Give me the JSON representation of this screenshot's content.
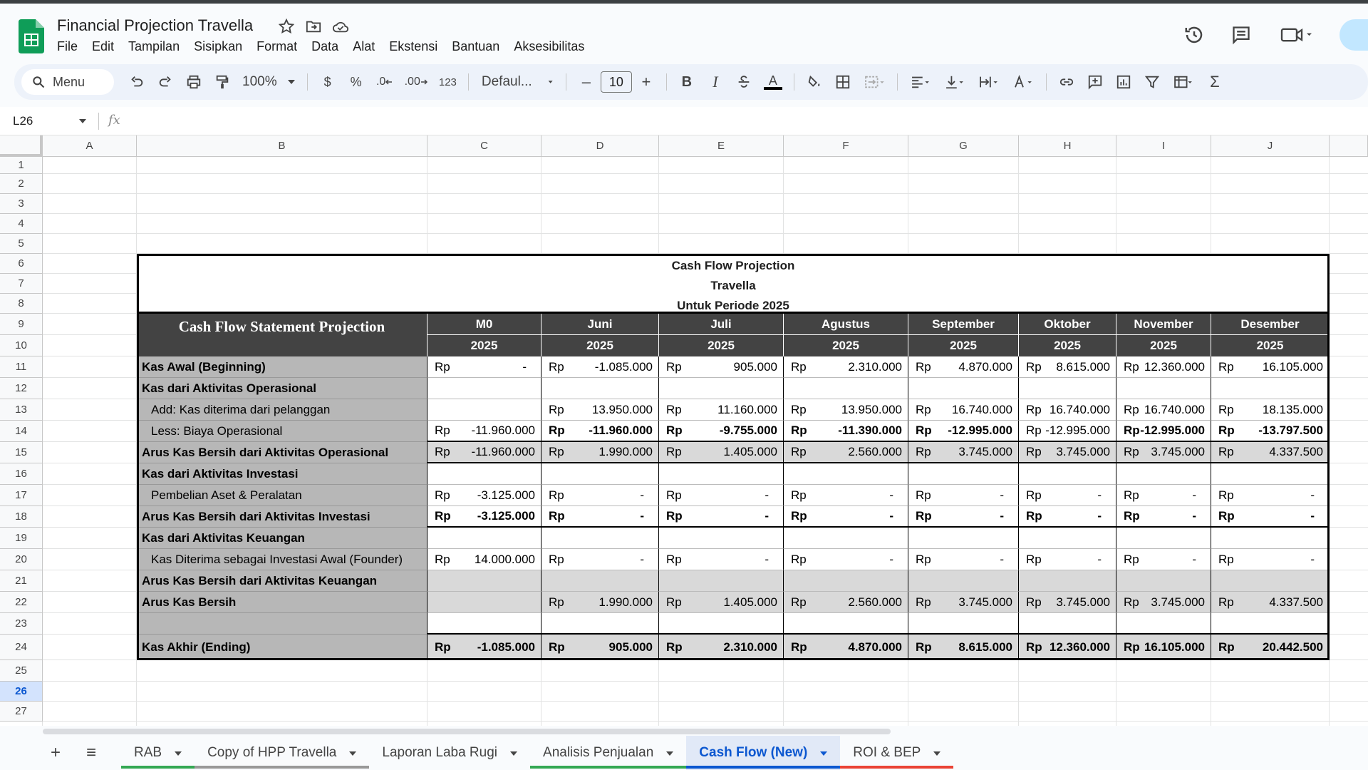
{
  "app": {
    "doc_title": "Financial Projection Travella",
    "menu": [
      "File",
      "Edit",
      "Tampilan",
      "Sisipkan",
      "Format",
      "Data",
      "Alat",
      "Ekstensi",
      "Bantuan",
      "Aksesibilitas"
    ]
  },
  "toolbar": {
    "search_label": "Menu",
    "zoom": "100%",
    "currency": "$",
    "percent": "%",
    "dec_dec": ".0",
    "dec_inc": ".00",
    "num_format": "123",
    "font": "Defaul...",
    "font_size": "10",
    "bold": "B",
    "italic": "I",
    "text_color": "A",
    "minus": "–",
    "plus": "+",
    "sum": "Σ"
  },
  "formula_bar": {
    "cell_ref": "L26",
    "fx": "fx"
  },
  "columns": [
    "A",
    "B",
    "C",
    "D",
    "E",
    "F",
    "G",
    "H",
    "I",
    "J"
  ],
  "rows": [
    "1",
    "2",
    "3",
    "4",
    "5",
    "6",
    "7",
    "8",
    "9",
    "10",
    "11",
    "12",
    "13",
    "14",
    "15",
    "16",
    "17",
    "18",
    "19",
    "20",
    "21",
    "22",
    "23",
    "24",
    "25",
    "26",
    "27"
  ],
  "sheet": {
    "title1": "Cash Flow Projection",
    "title2": "Travella",
    "title3": "Untuk Periode 2025",
    "statement_title": "Cash Flow Statement Projection",
    "months": [
      "M0",
      "Juni",
      "Juli",
      "Agustus",
      "September",
      "Oktober",
      "November",
      "Desember"
    ],
    "year": "2025",
    "currency": "Rp",
    "line_items": [
      {
        "label": "Kas Awal (Beginning)",
        "values": [
          "-",
          "-1.085.000",
          "905.000",
          "2.310.000",
          "4.870.000",
          "8.615.000",
          "12.360.000",
          "16.105.000"
        ]
      },
      {
        "label": "Kas dari Aktivitas Operasional",
        "values": []
      },
      {
        "label": "Add: Kas diterima dari pelanggan",
        "values": [
          "",
          "13.950.000",
          "11.160.000",
          "13.950.000",
          "16.740.000",
          "16.740.000",
          "16.740.000",
          "18.135.000"
        ]
      },
      {
        "label": "Less: Biaya Operasional",
        "values": [
          "-11.960.000",
          "-11.960.000",
          "-9.755.000",
          "-11.390.000",
          "-12.995.000",
          "-12.995.000",
          "-12.995.000",
          "-13.797.500"
        ]
      },
      {
        "label": "Arus Kas Bersih dari Aktivitas Operasional",
        "values": [
          "-11.960.000",
          "1.990.000",
          "1.405.000",
          "2.560.000",
          "3.745.000",
          "3.745.000",
          "3.745.000",
          "4.337.500"
        ]
      },
      {
        "label": "Kas dari Aktivitas Investasi",
        "values": []
      },
      {
        "label": "Pembelian Aset & Peralatan",
        "values": [
          "-3.125.000",
          "-",
          "-",
          "-",
          "-",
          "-",
          "-",
          "-"
        ]
      },
      {
        "label": "Arus Kas Bersih dari Aktivitas Investasi",
        "values": [
          "-3.125.000",
          "-",
          "-",
          "-",
          "-",
          "-",
          "-",
          "-"
        ]
      },
      {
        "label": "Kas dari Aktivitas Keuangan",
        "values": []
      },
      {
        "label": "Kas Diterima sebagai Investasi Awal (Founder)",
        "values": [
          "14.000.000",
          "-",
          "-",
          "-",
          "-",
          "-",
          "-",
          "-"
        ]
      },
      {
        "label": "Arus Kas Bersih dari Aktivitas Keuangan",
        "values": []
      },
      {
        "label": "Arus Kas Bersih",
        "values": [
          "",
          "1.990.000",
          "1.405.000",
          "2.560.000",
          "3.745.000",
          "3.745.000",
          "3.745.000",
          "4.337.500"
        ]
      },
      {
        "label": "",
        "values": []
      },
      {
        "label": "Kas Akhir (Ending)",
        "values": [
          "-1.085.000",
          "905.000",
          "2.310.000",
          "4.870.000",
          "8.615.000",
          "12.360.000",
          "16.105.000",
          "20.442.500"
        ]
      }
    ]
  },
  "tabs": [
    {
      "label": "RAB",
      "color": "#34a853"
    },
    {
      "label": "Copy of HPP Travella",
      "color": "#999999"
    },
    {
      "label": "Laporan Laba Rugi",
      "color": ""
    },
    {
      "label": "Analisis Penjualan",
      "color": "#34a853"
    },
    {
      "label": "Cash Flow (New)",
      "color": "#0b57d0"
    },
    {
      "label": "ROI & BEP",
      "color": "#ea4335"
    }
  ],
  "sheetbar": {
    "add": "+",
    "all": "≡"
  }
}
